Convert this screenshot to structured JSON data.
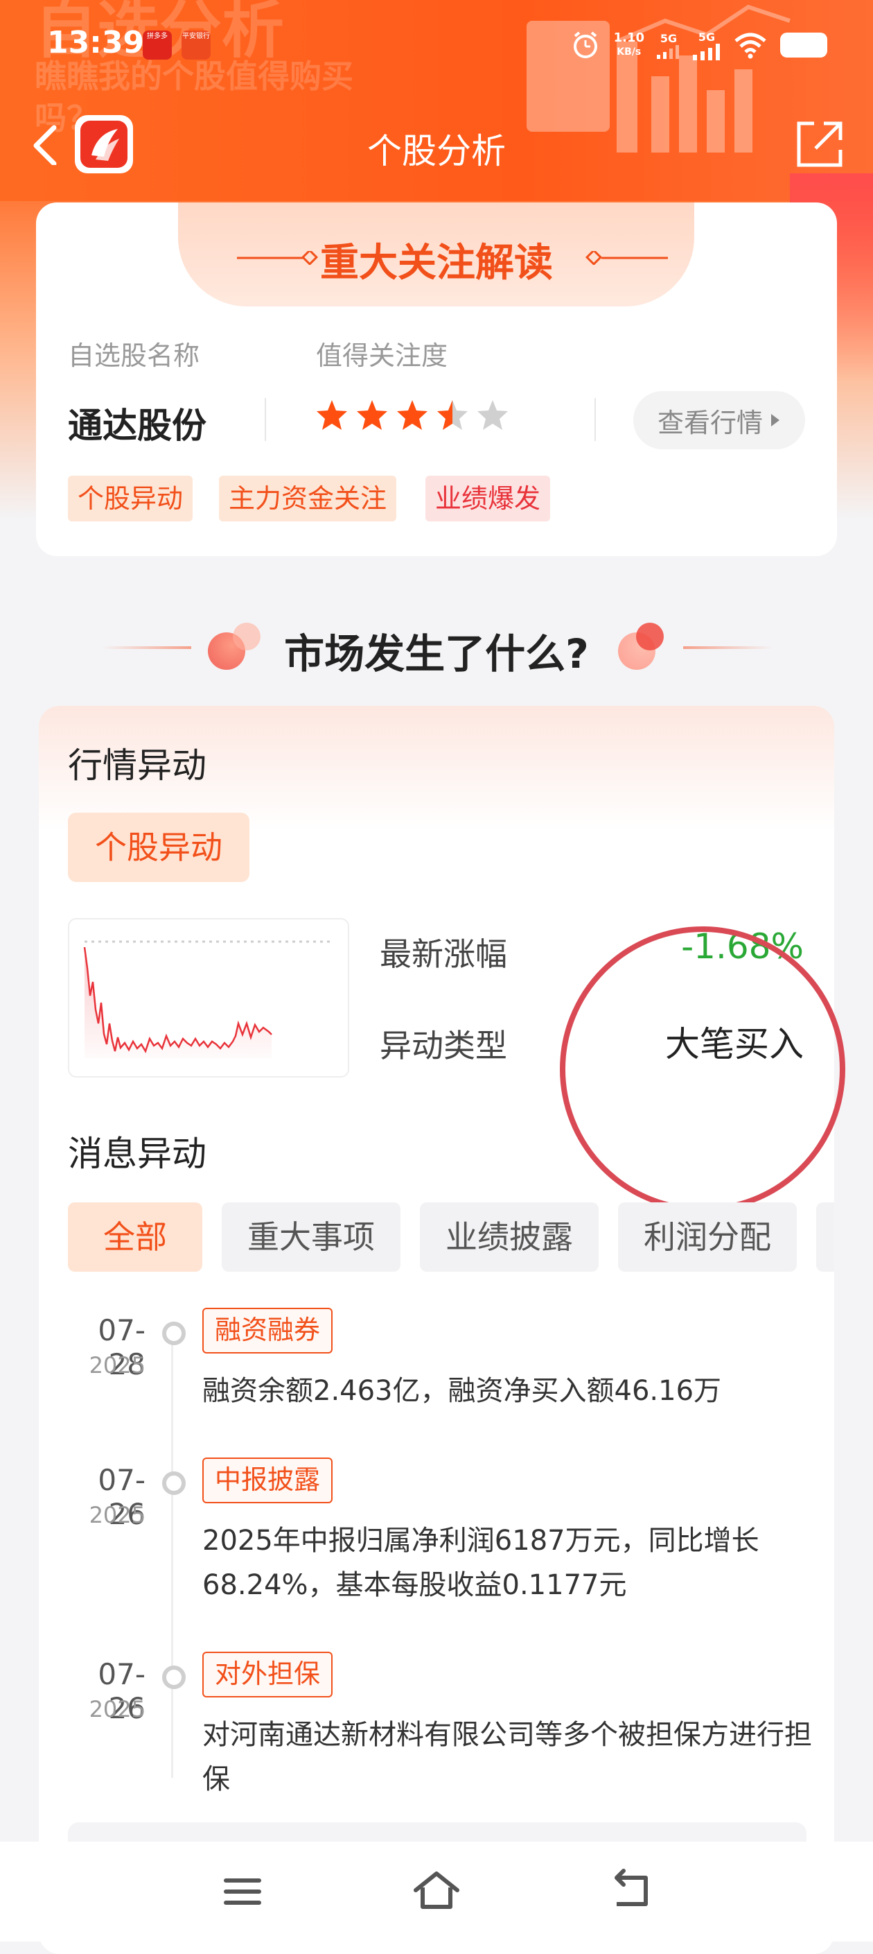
{
  "status_bar": {
    "time": "13:39",
    "apps": [
      "拼多多",
      "平安银行"
    ],
    "net_speed": "1.10",
    "net_unit": "KB/s",
    "sig1": "5G",
    "sig2": "5G"
  },
  "header": {
    "title": "个股分析",
    "banner_text_1": "自选分析",
    "banner_text_2": "瞧瞧我的个股值得购买吗？",
    "colors": {
      "accent": "#ff5a1a",
      "title_text": "#ffffff"
    }
  },
  "focus_card": {
    "title": "重大关注解读",
    "name_label": "自选股名称",
    "attention_label": "值得关注度",
    "stock_name": "通达股份",
    "rating": 3.5,
    "rating_max": 5,
    "view_quote_button": "查看行情",
    "tags": [
      {
        "label": "个股异动",
        "color": "orange"
      },
      {
        "label": "主力资金关注",
        "color": "orange"
      },
      {
        "label": "业绩爆发",
        "color": "red"
      }
    ]
  },
  "section_title": "市场发生了什么?",
  "market_card": {
    "quote_anomaly_title": "行情异动",
    "quote_anomaly_tag": "个股异动",
    "latest_change_label": "最新涨幅",
    "latest_change_value": "-1.68%",
    "anomaly_type_label": "异动类型",
    "anomaly_type_value": "大笔买入",
    "news_anomaly_title": "消息异动",
    "filters": [
      "全部",
      "重大事项",
      "业绩披露",
      "利润分配"
    ],
    "active_filter": 0,
    "timeline": [
      {
        "date": "07-28",
        "year": "2025",
        "tag": "融资融券",
        "text": "融资余额2.463亿，融资净买入额46.16万"
      },
      {
        "date": "07-26",
        "year": "2025",
        "tag": "中报披露",
        "text": "2025年中报归属净利润6187万元，同比增长68.24%，基本每股收益0.1177元"
      },
      {
        "date": "07-26",
        "year": "2025",
        "tag": "对外担保",
        "text": "对河南通达新材料有限公司等多个被担保方进行担保"
      }
    ],
    "colors": {
      "up_down": "#2aa836",
      "highlight": "#f2501a",
      "annotation_circle": "#d94a55"
    }
  },
  "bottom_nav": {
    "icons": [
      "menu-icon",
      "home-icon",
      "back-icon"
    ]
  }
}
